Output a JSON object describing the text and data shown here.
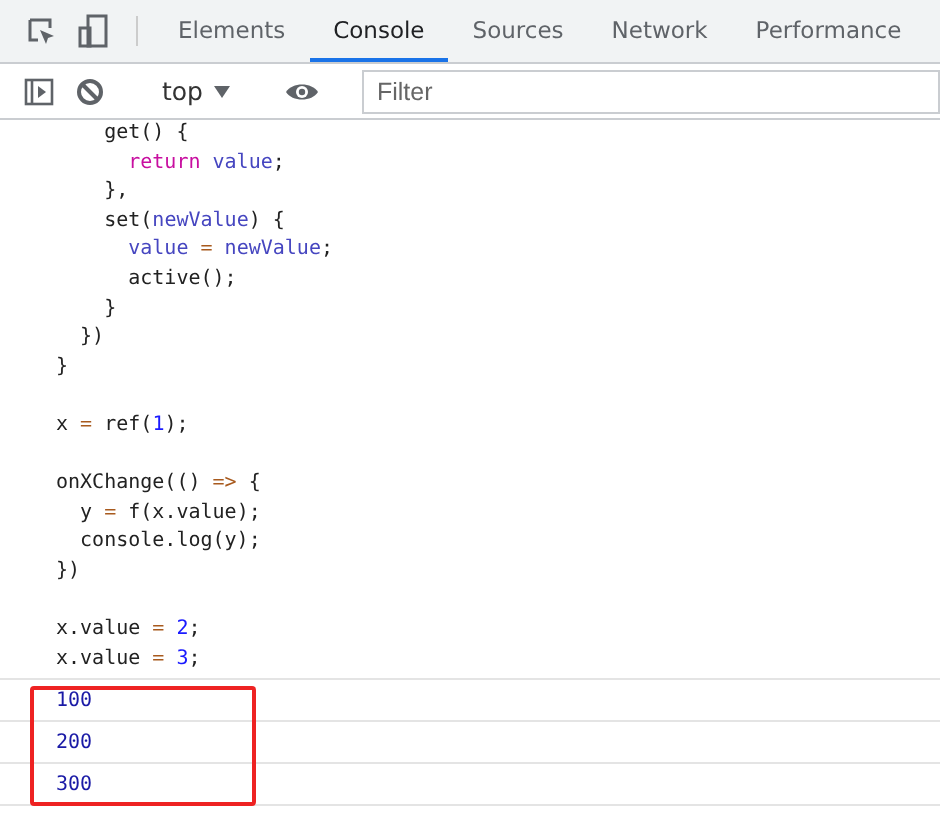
{
  "tabs": [
    {
      "label": "Elements",
      "selected": false
    },
    {
      "label": "Console",
      "selected": true
    },
    {
      "label": "Sources",
      "selected": false
    },
    {
      "label": "Network",
      "selected": false
    },
    {
      "label": "Performance",
      "selected": false
    }
  ],
  "toolbar": {
    "context": "top",
    "filter": {
      "placeholder": "Filter"
    }
  },
  "code_blocks": [
    [
      [
        {
          "text": "    get() {",
          "kind": "plain"
        }
      ],
      [
        {
          "text": "      return",
          "kind": "keyword"
        },
        {
          "text": " value",
          "kind": "variable"
        },
        {
          "text": ";",
          "kind": "plain"
        }
      ],
      [
        {
          "text": "    },",
          "kind": "plain"
        }
      ],
      [
        {
          "text": "    set(",
          "kind": "plain"
        },
        {
          "text": "newValue",
          "kind": "variable"
        },
        {
          "text": ") {",
          "kind": "plain"
        }
      ],
      [
        {
          "text": "      value",
          "kind": "variable"
        },
        {
          "text": " =",
          "kind": "operator"
        },
        {
          "text": " newValue",
          "kind": "variable"
        },
        {
          "text": ";",
          "kind": "plain"
        }
      ],
      [
        {
          "text": "      active();",
          "kind": "plain"
        }
      ],
      [
        {
          "text": "    }",
          "kind": "plain"
        }
      ],
      [
        {
          "text": "  })",
          "kind": "plain"
        }
      ],
      [
        {
          "text": "}",
          "kind": "plain"
        }
      ]
    ],
    [
      [
        {
          "text": "x ",
          "kind": "plain"
        },
        {
          "text": "=",
          "kind": "operator"
        },
        {
          "text": " ref(",
          "kind": "plain"
        },
        {
          "text": "1",
          "kind": "number"
        },
        {
          "text": ");",
          "kind": "plain"
        }
      ]
    ],
    [
      [
        {
          "text": "onXChange(() ",
          "kind": "plain"
        },
        {
          "text": "=>",
          "kind": "operator"
        },
        {
          "text": " {",
          "kind": "plain"
        }
      ],
      [
        {
          "text": "  y ",
          "kind": "plain"
        },
        {
          "text": "=",
          "kind": "operator"
        },
        {
          "text": " f(x.value);",
          "kind": "plain"
        }
      ],
      [
        {
          "text": "  console.log(y);",
          "kind": "plain"
        }
      ],
      [
        {
          "text": "})",
          "kind": "plain"
        }
      ]
    ],
    [
      [
        {
          "text": "x.value ",
          "kind": "plain"
        },
        {
          "text": "=",
          "kind": "operator"
        },
        {
          "text": " 2",
          "kind": "number"
        },
        {
          "text": ";",
          "kind": "plain"
        }
      ],
      [
        {
          "text": "x.value ",
          "kind": "plain"
        },
        {
          "text": "=",
          "kind": "operator"
        },
        {
          "text": " 3",
          "kind": "number"
        },
        {
          "text": ";",
          "kind": "plain"
        }
      ]
    ]
  ],
  "outputs": [
    "100",
    "200",
    "300"
  ]
}
